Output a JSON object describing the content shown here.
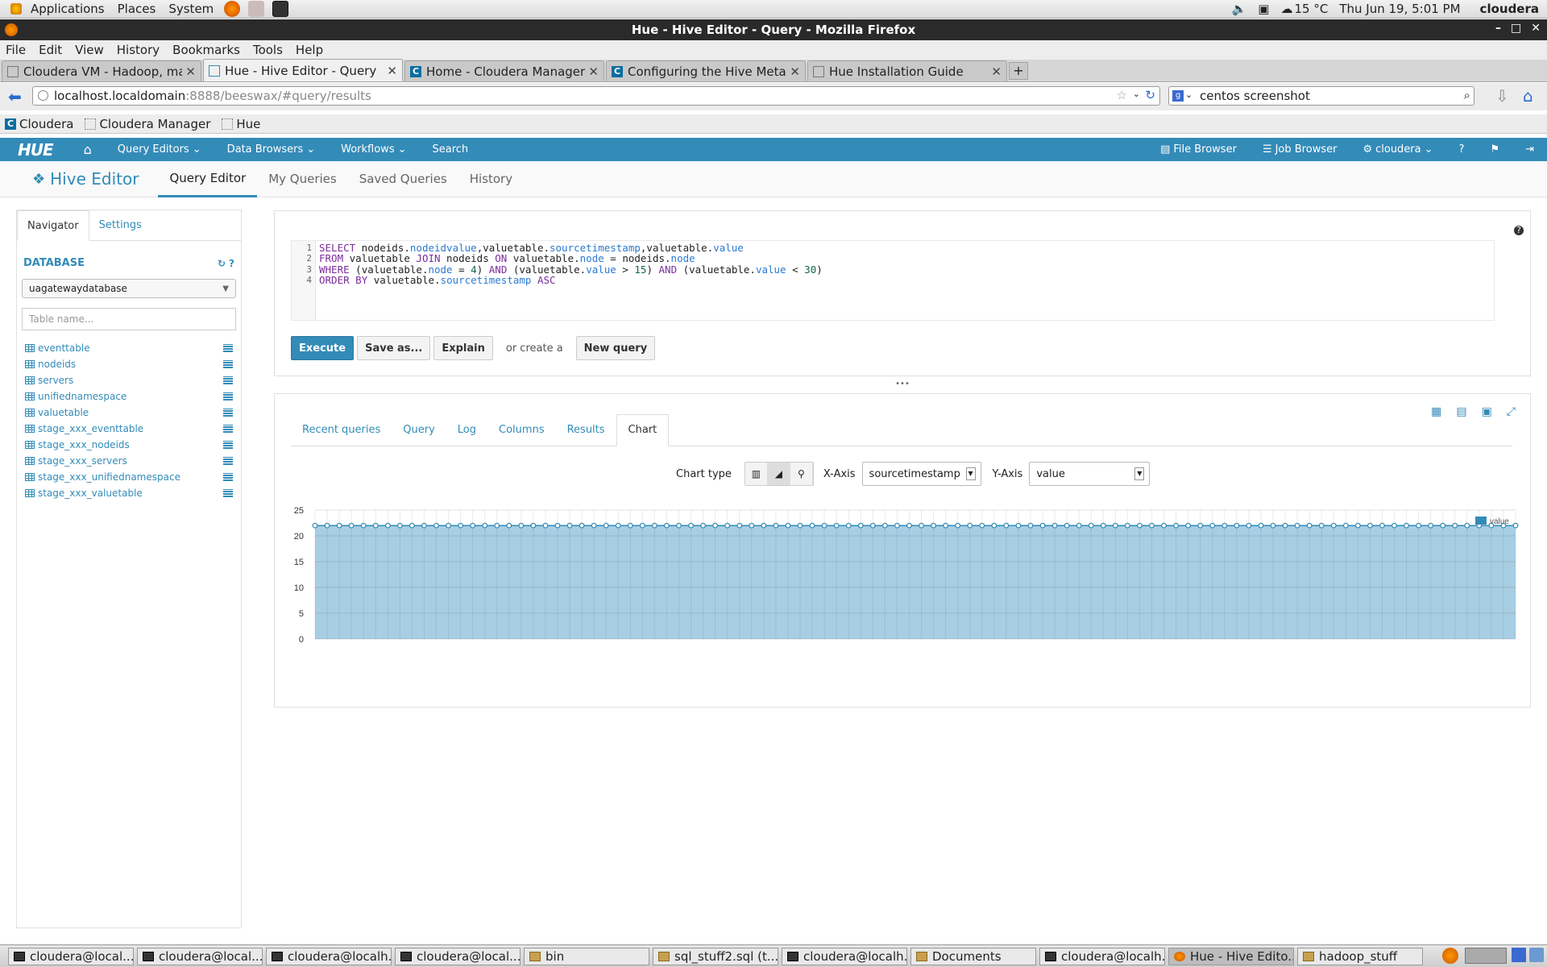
{
  "gnome": {
    "menus": [
      "Applications",
      "Places",
      "System"
    ],
    "weather": "15 °C",
    "datetime": "Thu Jun 19,  5:01 PM",
    "user": "cloudera"
  },
  "window": {
    "title": "Hue - Hive Editor - Query - Mozilla Firefox"
  },
  "firefox": {
    "menu": [
      "File",
      "Edit",
      "View",
      "History",
      "Bookmarks",
      "Tools",
      "Help"
    ],
    "tabs": [
      {
        "title": "Cloudera VM - Hadoop, mad..."
      },
      {
        "title": "Hue - Hive Editor - Query"
      },
      {
        "title": "Home - Cloudera Manager"
      },
      {
        "title": "Configuring the Hive Metast..."
      },
      {
        "title": "Hue Installation Guide"
      }
    ],
    "url_host": "localhost.localdomain",
    "url_rest": ":8888/beeswax/#query/results",
    "search_value": "centos screenshot",
    "bookmarks": [
      "Cloudera",
      "Cloudera Manager",
      "Hue"
    ]
  },
  "hue": {
    "logo": "HUE",
    "nav": [
      "Query Editors",
      "Data Browsers",
      "Workflows",
      "Search"
    ],
    "nav_right": [
      "File Browser",
      "Job Browser",
      "cloudera"
    ],
    "app_title": "Hive Editor",
    "subnav": [
      "Query Editor",
      "My Queries",
      "Saved Queries",
      "History"
    ]
  },
  "sidebar": {
    "tabs": [
      "Navigator",
      "Settings"
    ],
    "db_header": "DATABASE",
    "db_selected": "uagatewaydatabase",
    "filter_placeholder": "Table name...",
    "tables": [
      "eventtable",
      "nodeids",
      "servers",
      "unifiednamespace",
      "valuetable",
      "stage_xxx_eventtable",
      "stage_xxx_nodeids",
      "stage_xxx_servers",
      "stage_xxx_unifiednamespace",
      "stage_xxx_valuetable"
    ]
  },
  "editor": {
    "line_numbers": [
      "1",
      "2",
      "3",
      "4"
    ],
    "lines": [
      "SELECT nodeids.nodeidvalue,valuetable.sourcetimestamp,valuetable.value",
      "FROM valuetable JOIN nodeids ON valuetable.node = nodeids.node",
      "WHERE (valuetable.node = 4) AND (valuetable.value > 15) AND (valuetable.value < 30)",
      "ORDER BY valuetable.sourcetimestamp ASC"
    ],
    "buttons": {
      "execute": "Execute",
      "save": "Save as...",
      "explain": "Explain",
      "or_create": "or create a",
      "new_query": "New query"
    }
  },
  "results": {
    "tabs": [
      "Recent queries",
      "Query",
      "Log",
      "Columns",
      "Results",
      "Chart"
    ],
    "chart_type_label": "Chart type",
    "x_axis_label": "X-Axis",
    "x_axis_value": "sourcetimestamp",
    "y_axis_label": "Y-Axis",
    "y_axis_value": "value"
  },
  "chart_data": {
    "type": "area",
    "series": [
      {
        "name": "value",
        "value": 22,
        "count": 100
      }
    ],
    "y_ticks": [
      0,
      5,
      10,
      15,
      20,
      25
    ],
    "ylim": [
      0,
      25
    ],
    "legend": "top-right",
    "grid": true,
    "color": "#338bb8"
  },
  "taskbar": [
    {
      "label": "cloudera@local...",
      "icon": "terminal"
    },
    {
      "label": "cloudera@local...",
      "icon": "terminal"
    },
    {
      "label": "cloudera@localh...",
      "icon": "terminal"
    },
    {
      "label": "cloudera@local...",
      "icon": "terminal"
    },
    {
      "label": "bin",
      "icon": "folder"
    },
    {
      "label": "sql_stuff2.sql (t...",
      "icon": "editor"
    },
    {
      "label": "cloudera@localh...",
      "icon": "terminal"
    },
    {
      "label": "Documents",
      "icon": "folder"
    },
    {
      "label": "cloudera@localh...",
      "icon": "terminal"
    },
    {
      "label": "Hue - Hive Edito...",
      "icon": "firefox"
    },
    {
      "label": "hadoop_stuff",
      "icon": "folder"
    }
  ]
}
